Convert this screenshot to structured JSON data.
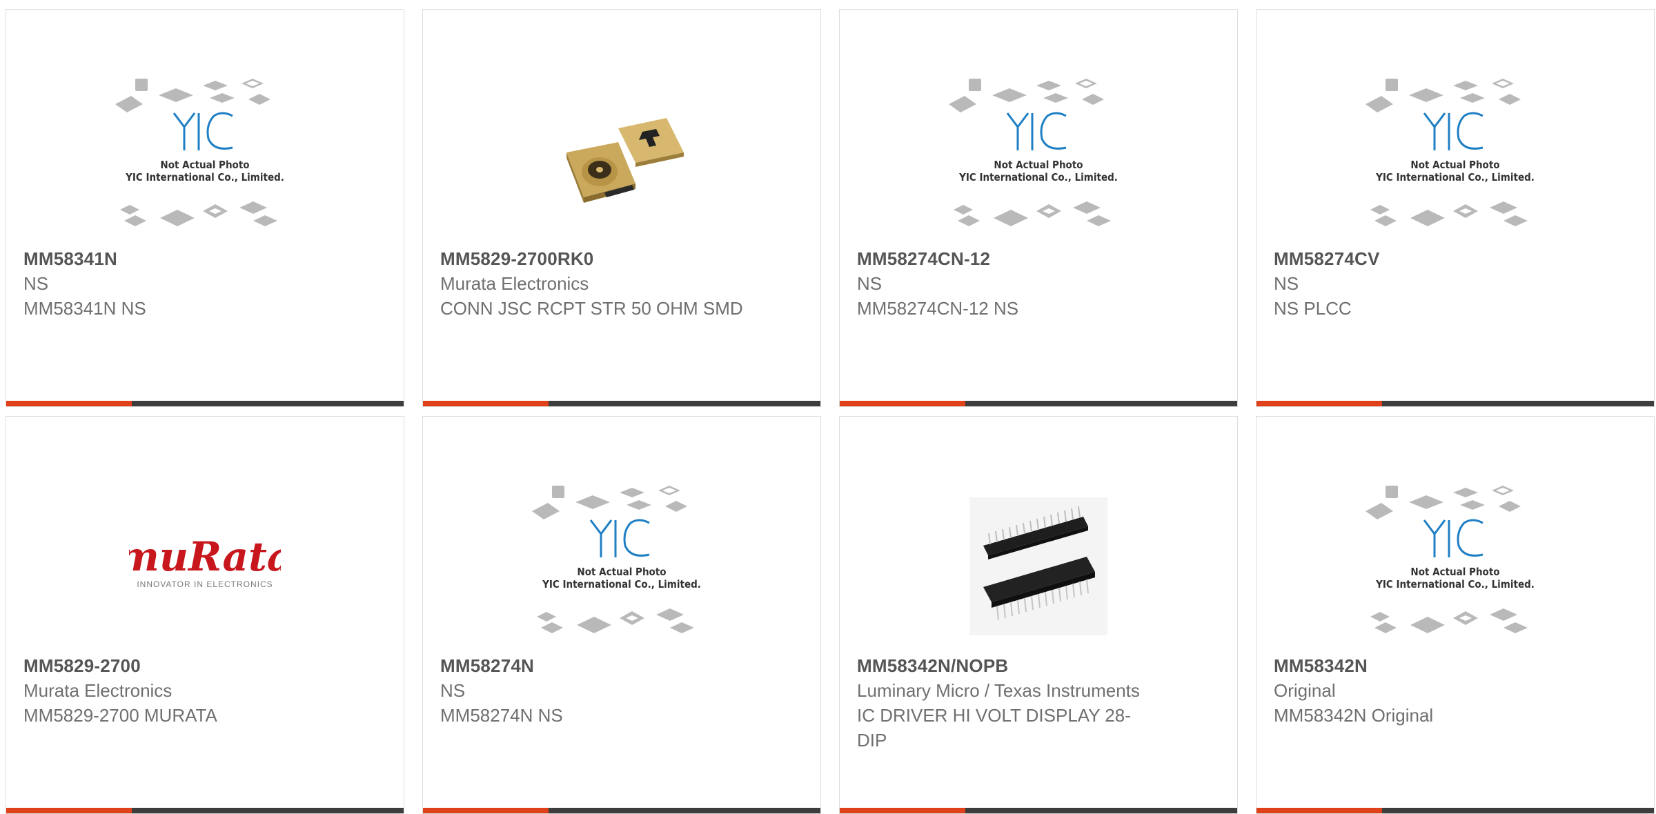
{
  "products": [
    {
      "part_number": "MM58341N",
      "manufacturer": "NS",
      "description": "MM58341N NS",
      "image": "yic-placeholder",
      "image_text": [
        "Not Actual Photo",
        "YIC International Co., Limited."
      ]
    },
    {
      "part_number": "MM5829-2700RK0",
      "manufacturer": "Murata Electronics",
      "description": "CONN JSC RCPT STR 50 OHM SMD",
      "image": "connector-photo"
    },
    {
      "part_number": "MM58274CN-12",
      "manufacturer": "NS",
      "description": "MM58274CN-12 NS",
      "image": "yic-placeholder",
      "image_text": [
        "Not Actual Photo",
        "YIC International Co., Limited."
      ]
    },
    {
      "part_number": "MM58274CV",
      "manufacturer": "NS",
      "description": "NS PLCC",
      "image": "yic-placeholder",
      "image_text": [
        "Not Actual Photo",
        "YIC International Co., Limited."
      ]
    },
    {
      "part_number": "MM5829-2700",
      "manufacturer": "Murata Electronics",
      "description": "MM5829-2700 MURATA",
      "image": "murata-logo",
      "image_text": [
        "muRata",
        "INNOVATOR IN ELECTRONICS"
      ]
    },
    {
      "part_number": "MM58274N",
      "manufacturer": "NS",
      "description": "MM58274N NS",
      "image": "yic-placeholder",
      "image_text": [
        "Not Actual Photo",
        "YIC International Co., Limited."
      ]
    },
    {
      "part_number": "MM58342N/NOPB",
      "manufacturer": "Luminary Micro / Texas Instruments",
      "description": "IC DRIVER HI VOLT DISPLAY 28-DIP",
      "image": "dip-chip-photo"
    },
    {
      "part_number": "MM58342N",
      "manufacturer": "Original",
      "description": "MM58342N Original",
      "image": "yic-placeholder",
      "image_text": [
        "Not Actual Photo",
        "YIC International Co., Limited."
      ]
    }
  ],
  "colors": {
    "accent": "#e0401a",
    "bar": "#3d3d3d",
    "text_primary": "#555555",
    "text_secondary": "#6f6f6f",
    "yic_blue": "#1f7fc4",
    "murata_red": "#c8161d"
  }
}
